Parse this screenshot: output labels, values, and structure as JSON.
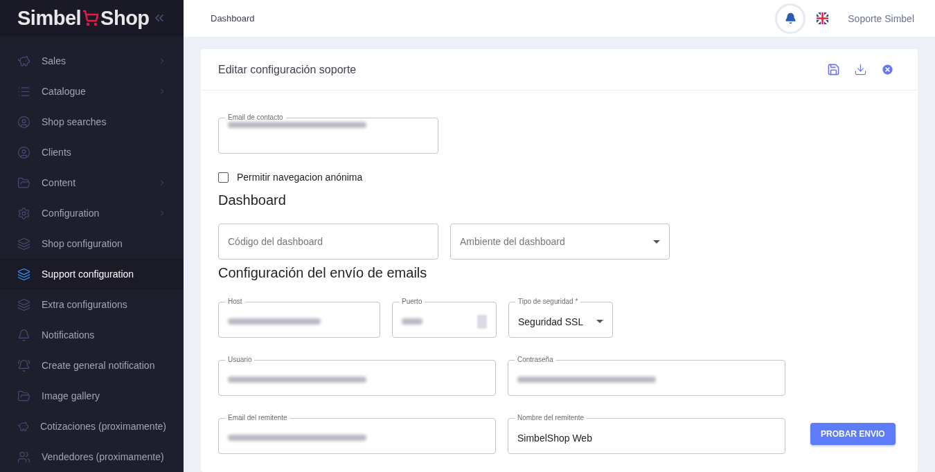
{
  "brand": {
    "first": "Simbel",
    "second": "Shop"
  },
  "sidebar": {
    "items": [
      {
        "label": "Sales",
        "has_submenu": true,
        "selected": false
      },
      {
        "label": "Catalogue",
        "has_submenu": true,
        "selected": false
      },
      {
        "label": "Shop searches",
        "has_submenu": false,
        "selected": false
      },
      {
        "label": "Clients",
        "has_submenu": false,
        "selected": false
      },
      {
        "label": "Content",
        "has_submenu": true,
        "selected": false
      },
      {
        "label": "Configuration",
        "has_submenu": true,
        "selected": false
      },
      {
        "label": "Shop configuration",
        "has_submenu": false,
        "selected": false
      },
      {
        "label": "Support configuration",
        "has_submenu": false,
        "selected": true
      },
      {
        "label": "Extra configurations",
        "has_submenu": false,
        "selected": false
      },
      {
        "label": "Notifications",
        "has_submenu": false,
        "selected": false
      },
      {
        "label": "Create general notification",
        "has_submenu": false,
        "selected": false
      },
      {
        "label": "Image gallery",
        "has_submenu": false,
        "selected": false
      },
      {
        "label": "Cotizaciones (proximamente)",
        "has_submenu": false,
        "selected": false
      },
      {
        "label": "Vendedores (proximamente)",
        "has_submenu": false,
        "selected": false
      }
    ]
  },
  "topbar": {
    "breadcrumb": "Dashboard",
    "user": "Soporte Simbel"
  },
  "card": {
    "title": "Editar configuración soporte",
    "contact": {
      "label": "Email de contacto",
      "redacted": true
    },
    "checkbox": {
      "label": "Permitir navegacion anónima",
      "checked": false
    },
    "sections": [
      {
        "heading": "Dashboard",
        "rows": [
          [
            {
              "kind": "text",
              "placeholder": "Código del dashboard"
            },
            {
              "kind": "select",
              "placeholder": "Ambiente del dashboard"
            }
          ]
        ]
      },
      {
        "heading": "Configuración del envío de emails",
        "rows": [
          [
            {
              "kind": "text",
              "label": "Host",
              "redacted": true
            },
            {
              "kind": "number",
              "label": "Puerto",
              "redacted": true
            },
            {
              "kind": "select",
              "label": "Tipo de seguridad *",
              "value": "Seguridad SSL"
            }
          ],
          [
            {
              "kind": "text",
              "label": "Usuario",
              "redacted": true
            },
            {
              "kind": "text",
              "label": "Contraseña",
              "redacted": true
            }
          ],
          [
            {
              "kind": "text",
              "label": "Email del remitente",
              "redacted": true
            },
            {
              "kind": "text",
              "label": "Nombre del remitente",
              "value": "SimbelShop Web"
            }
          ]
        ]
      }
    ],
    "test_button": "PROBAR ENVIO"
  }
}
